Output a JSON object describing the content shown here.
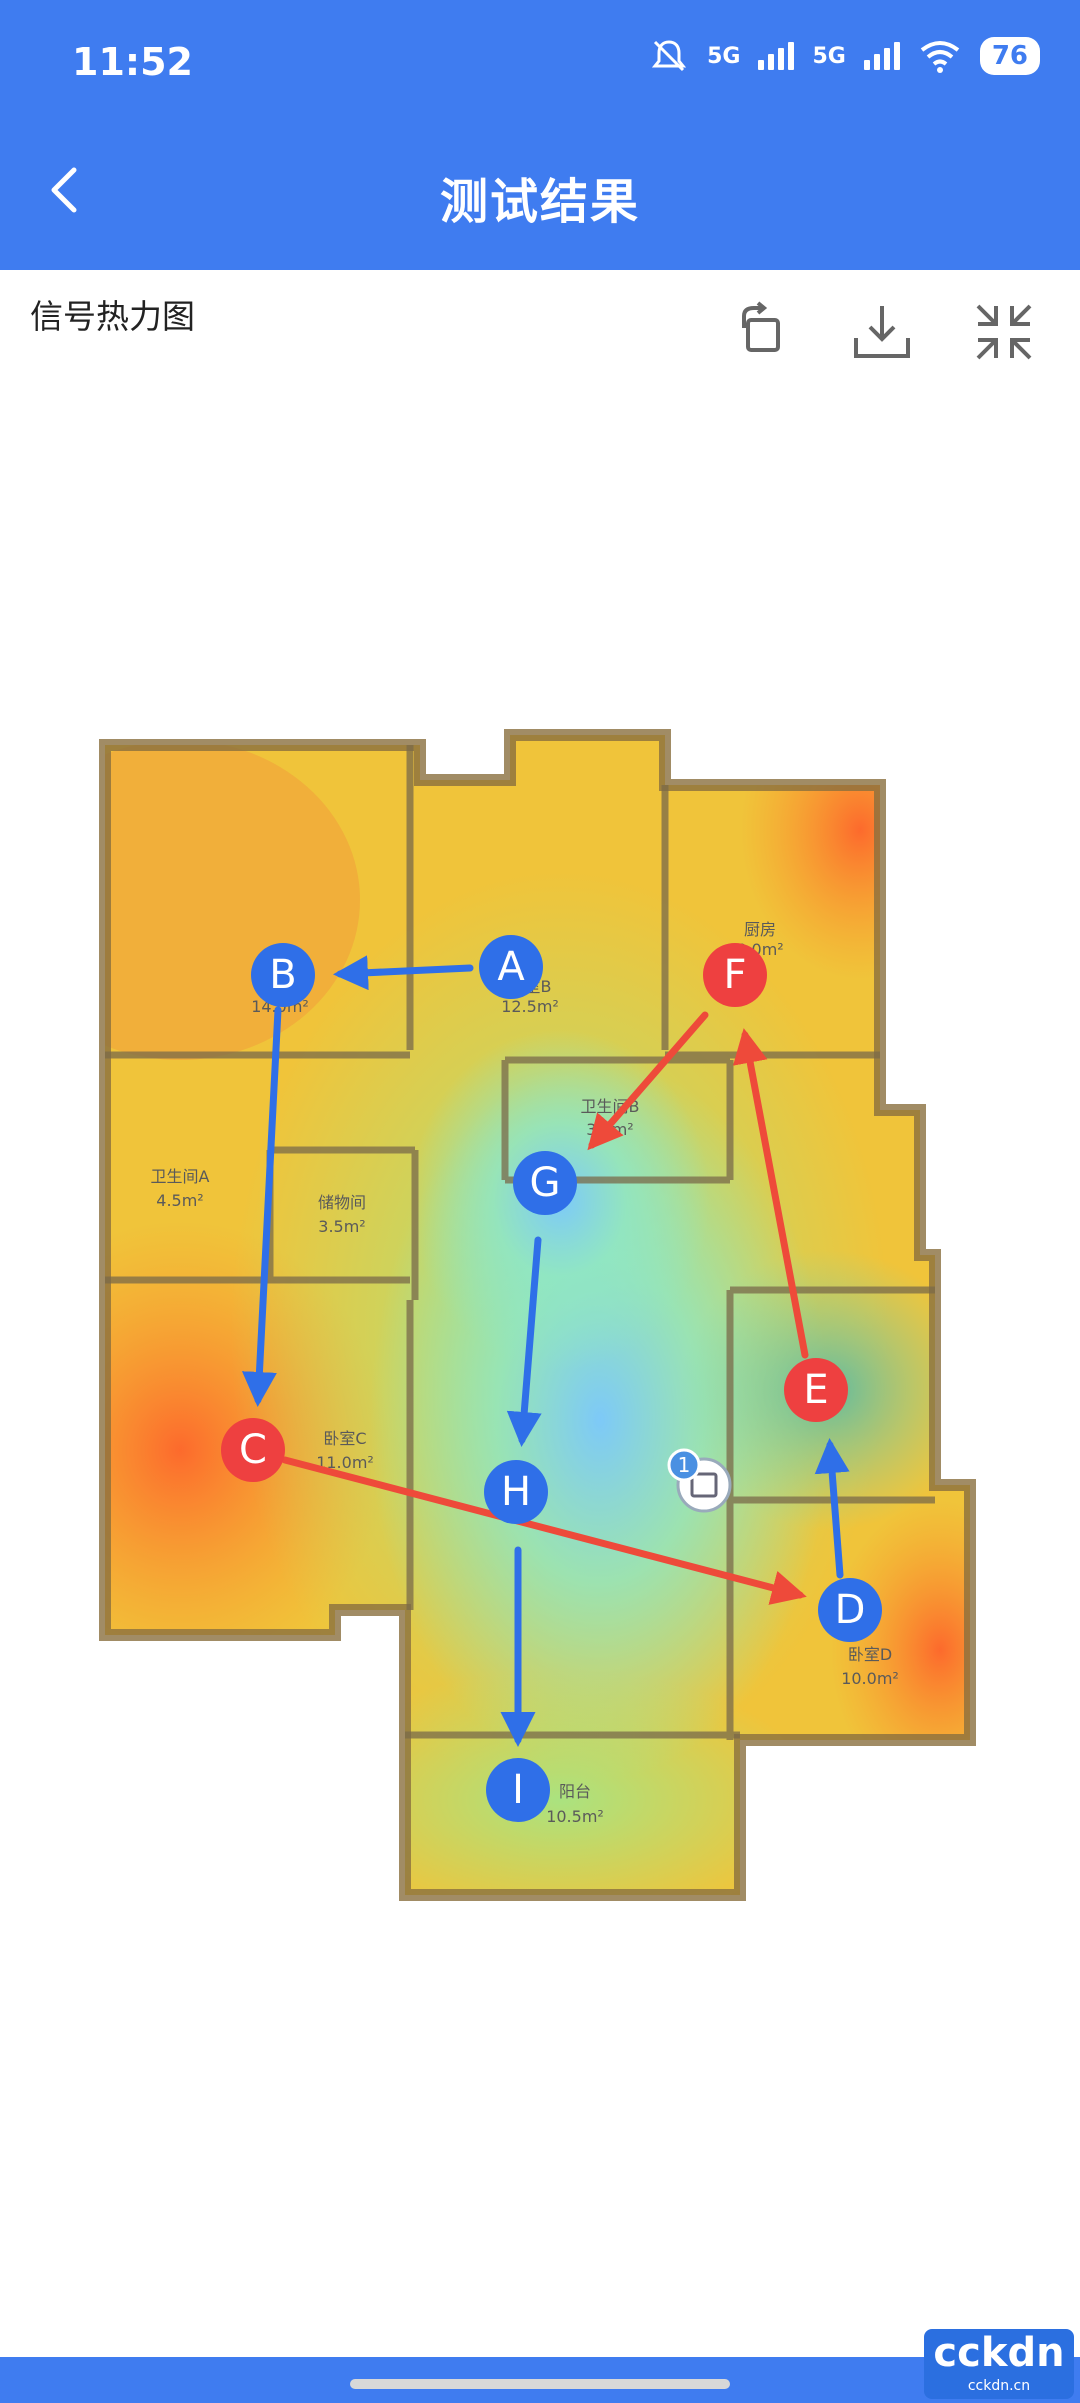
{
  "status_bar": {
    "time": "11:52",
    "net1": "5G",
    "net2": "5G",
    "battery": "76"
  },
  "header": {
    "title": "测试结果"
  },
  "section": {
    "label": "信号热力图"
  },
  "rooms": {
    "bed_a": "A",
    "bed_a_area": "14.0m²",
    "bed_b": "卧室B",
    "bed_b_area": "12.5m²",
    "kitchen": "厨房",
    "kitchen_area": "8.0m²",
    "bath_b": "卫生间B",
    "bath_b_area": "3.8m²",
    "bath_a": "卫生间A",
    "bath_a_area": "4.5m²",
    "storage": "储物间",
    "storage_area": "3.5m²",
    "bed_c": "卧室C",
    "bed_c_area": "11.0m²",
    "bed_d": "卧室D",
    "bed_d_area": "10.0m²",
    "balcony": "阳台",
    "balcony_area": "10.5m²"
  },
  "test_points": [
    {
      "label": "A",
      "status": "good",
      "color": "#2f6fe8"
    },
    {
      "label": "B",
      "status": "good",
      "color": "#2f6fe8"
    },
    {
      "label": "C",
      "status": "weak",
      "color": "#ee4040"
    },
    {
      "label": "D",
      "status": "good",
      "color": "#2f6fe8"
    },
    {
      "label": "E",
      "status": "weak",
      "color": "#ee4040"
    },
    {
      "label": "F",
      "status": "weak",
      "color": "#ee4040"
    },
    {
      "label": "G",
      "status": "good",
      "color": "#2f6fe8"
    },
    {
      "label": "H",
      "status": "good",
      "color": "#2f6fe8"
    },
    {
      "label": "I",
      "status": "good",
      "color": "#2f6fe8"
    }
  ],
  "router": {
    "badge": "1"
  },
  "watermark": {
    "line1": "cckdn",
    "line2": "cckdn.cn"
  },
  "colors": {
    "accent": "#3f7cf0",
    "point_good": "#2f6fe8",
    "point_weak": "#ee4040"
  }
}
